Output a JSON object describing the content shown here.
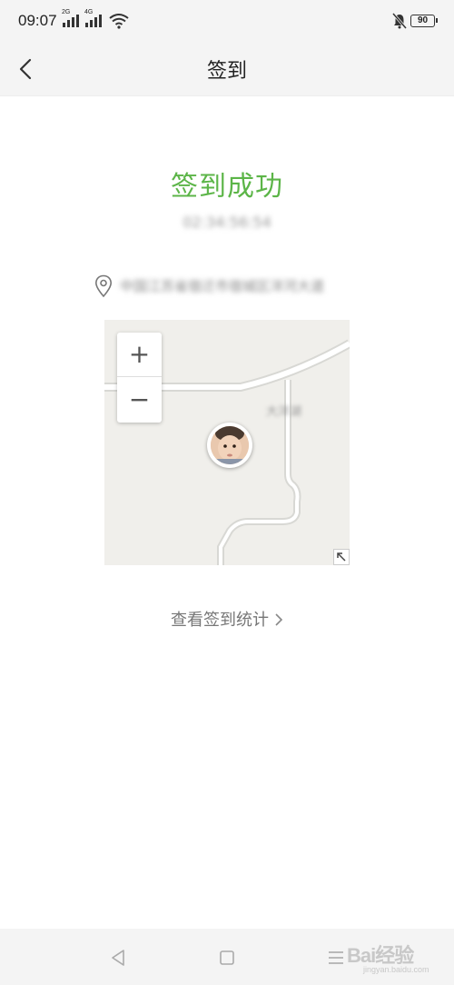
{
  "status_bar": {
    "time": "09:07",
    "signal_1_label": "2G",
    "signal_2_label": "4G",
    "battery": "90",
    "icons": [
      "signal-icon",
      "signal-icon",
      "wifi-icon",
      "mute-icon",
      "battery-icon"
    ]
  },
  "header": {
    "title": "签到",
    "back_icon": "chevron-left-icon"
  },
  "main": {
    "success_title": "签到成功",
    "time": "02:34:56:54",
    "location": "中国江苏省宿迁市宿城区洋河大道",
    "location_icon": "location-pin-icon",
    "map": {
      "zoom_in_label": "+",
      "zoom_out_label": "−",
      "map_label": "大洋湖",
      "expand_icon": "expand-arrow-icon",
      "avatar": "user-avatar"
    },
    "stats_link": "查看签到统计"
  },
  "nav_bar": {
    "icons": [
      "back-triangle-icon",
      "home-square-icon",
      "menu-lines-icon"
    ]
  },
  "watermark": {
    "main": "Bai经验",
    "sub": "jingyan.baidu.com"
  },
  "colors": {
    "success": "#5cb548",
    "background": "#ffffff",
    "bar": "#f4f4f4"
  }
}
